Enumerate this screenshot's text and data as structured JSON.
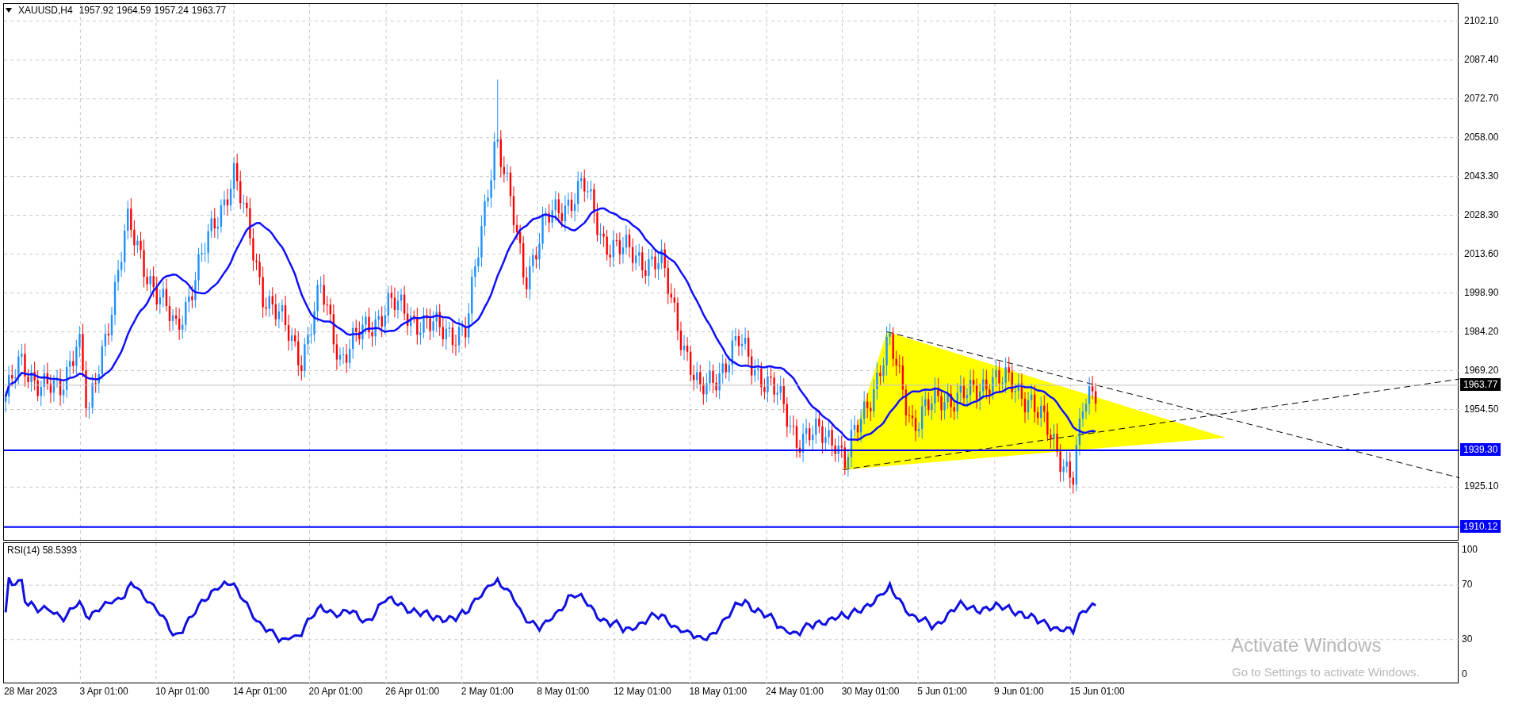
{
  "header": {
    "symbol": "XAUUSD,H4",
    "quote": [
      "1957.92",
      "1964.59",
      "1957.24",
      "1963.77"
    ]
  },
  "price_axis": {
    "labels": [
      "2102.10",
      "2087.40",
      "2072.70",
      "2058.00",
      "2043.30",
      "2028.30",
      "2013.60",
      "1998.90",
      "1984.20",
      "1969.20",
      "1954.50",
      "1925.10"
    ]
  },
  "price_tags": [
    {
      "text": "1963.77",
      "kind": "current"
    },
    {
      "text": "1939.30",
      "kind": "level"
    },
    {
      "text": "1910.12",
      "kind": "level"
    }
  ],
  "rsi": {
    "label": "RSI(14) 58.5393",
    "levels": [
      "100",
      "70",
      "30",
      "0"
    ]
  },
  "time_axis": {
    "labels": [
      "28 Mar 2023",
      "3 Apr 01:00",
      "10 Apr 01:00",
      "14 Apr 01:00",
      "20 Apr 01:00",
      "26 Apr 01:00",
      "2 May 01:00",
      "8 May 01:00",
      "12 May 01:00",
      "18 May 01:00",
      "24 May 01:00",
      "30 May 01:00",
      "5 Jun 01:00",
      "9 Jun 01:00",
      "15 Jun 01:00"
    ]
  },
  "os_overlay": {
    "title": "Activate Windows",
    "subtitle": "Go to Settings to activate Windows."
  }
}
